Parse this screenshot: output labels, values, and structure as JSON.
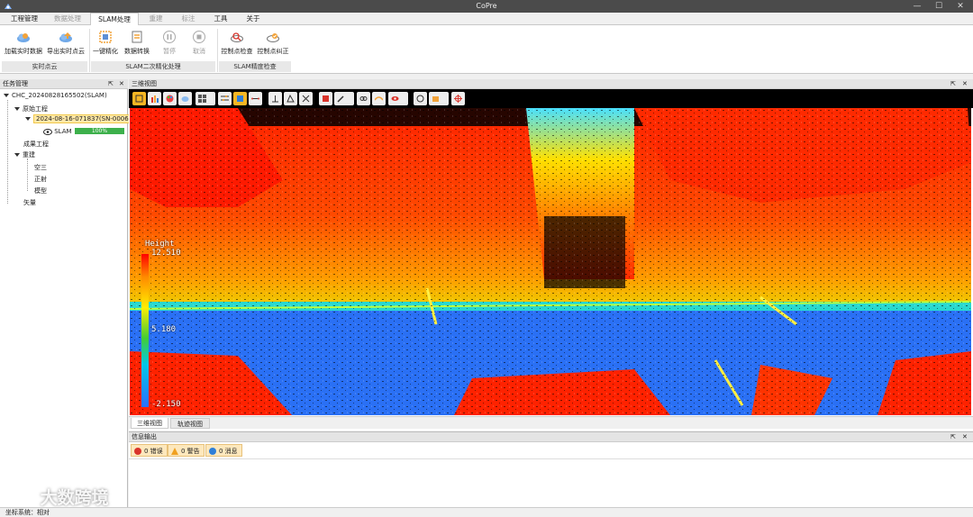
{
  "app": {
    "title": "CoPre"
  },
  "menu": [
    {
      "label": "工程管理",
      "state": "normal"
    },
    {
      "label": "数据处理",
      "state": "disabled"
    },
    {
      "label": "SLAM处理",
      "state": "active"
    },
    {
      "label": "重建",
      "state": "disabled"
    },
    {
      "label": "标注",
      "state": "disabled"
    },
    {
      "label": "工具",
      "state": "normal"
    },
    {
      "label": "关于",
      "state": "normal"
    }
  ],
  "ribbon": {
    "buttons": {
      "load_realtime": "加载实时数据",
      "export_realtime": "导出实时点云",
      "one_click_refine": "一键精化",
      "data_convert": "数据转换",
      "pause": "暂停",
      "cancel": "取消",
      "checkpoint_check": "控制点检查",
      "checkpoint_correct": "控制点纠正"
    },
    "groups": {
      "realtime": "实时点云",
      "slam_refine": "SLAM二次精化处理",
      "slam_accuracy": "SLAM精度检查"
    }
  },
  "task_panel": {
    "title": "任务管理",
    "project": "CHC_20240828165502(SLAM)",
    "raw_project": "原始工程",
    "dataset": "2024-08-16-071837(SN-0006)",
    "slam_label": "SLAM",
    "slam_progress": "100%",
    "result_project": "成果工程",
    "rebuild": "重建",
    "aerial": "空三",
    "ortho": "正射",
    "model": "模型",
    "vector": "矢量"
  },
  "view3d": {
    "title": "三维视图",
    "legend_title": "Height",
    "legend_max": "12.510",
    "legend_mid": "5.180",
    "legend_min": "-2.150",
    "tabs": [
      "三维视图",
      "轨迹视图"
    ]
  },
  "info_panel": {
    "title": "信息输出",
    "errors": "0 错误",
    "warnings": "0 警告",
    "messages": "0 消息"
  },
  "status": {
    "text": "坐标系统：相对"
  },
  "watermark": "大数跨境",
  "colors": {
    "accent": "#f5b623",
    "progress": "#3db04b",
    "error": "#d9342b",
    "warning": "#f0a020",
    "info": "#2f7fd8"
  }
}
